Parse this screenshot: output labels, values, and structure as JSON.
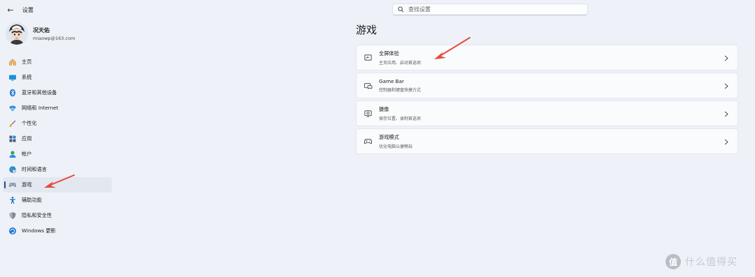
{
  "window": {
    "title": "设置"
  },
  "search": {
    "placeholder": "查找设置"
  },
  "profile": {
    "name": "况天佑",
    "email": "miaowp@163.com"
  },
  "nav": {
    "items": [
      {
        "label": "主页",
        "icon": "home-icon",
        "active": false
      },
      {
        "label": "系统",
        "icon": "system-icon",
        "active": false
      },
      {
        "label": "蓝牙和其他设备",
        "icon": "bluetooth-icon",
        "active": false
      },
      {
        "label": "网络和 Internet",
        "icon": "network-icon",
        "active": false
      },
      {
        "label": "个性化",
        "icon": "personalization-icon",
        "active": false
      },
      {
        "label": "应用",
        "icon": "apps-icon",
        "active": false
      },
      {
        "label": "帐户",
        "icon": "account-icon",
        "active": false
      },
      {
        "label": "时间和语言",
        "icon": "time-language-icon",
        "active": false
      },
      {
        "label": "游戏",
        "icon": "gaming-icon",
        "active": true
      },
      {
        "label": "辅助功能",
        "icon": "accessibility-icon",
        "active": false
      },
      {
        "label": "隐私和安全性",
        "icon": "privacy-shield-icon",
        "active": false
      },
      {
        "label": "Windows 更新",
        "icon": "windows-update-icon",
        "active": false
      }
    ]
  },
  "page": {
    "title": "游戏",
    "cards": [
      {
        "title": "全屏体验",
        "desc": "主页应用、启动首选项",
        "icon": "fullscreen-experience-icon"
      },
      {
        "title": "Game Bar",
        "desc": "控制器和键盘快捷方式",
        "icon": "game-bar-icon"
      },
      {
        "title": "摄像",
        "desc": "保存位置、录制首选项",
        "icon": "captures-icon"
      },
      {
        "title": "游戏模式",
        "desc": "优化电脑以便畅玩",
        "icon": "game-mode-icon"
      }
    ]
  },
  "watermark": {
    "text": "什么值得买",
    "logo_char": "值"
  },
  "colors": {
    "accent": "#1f4c8f",
    "annotation_arrow": "#e84a3c",
    "background": "#eef2f8"
  }
}
